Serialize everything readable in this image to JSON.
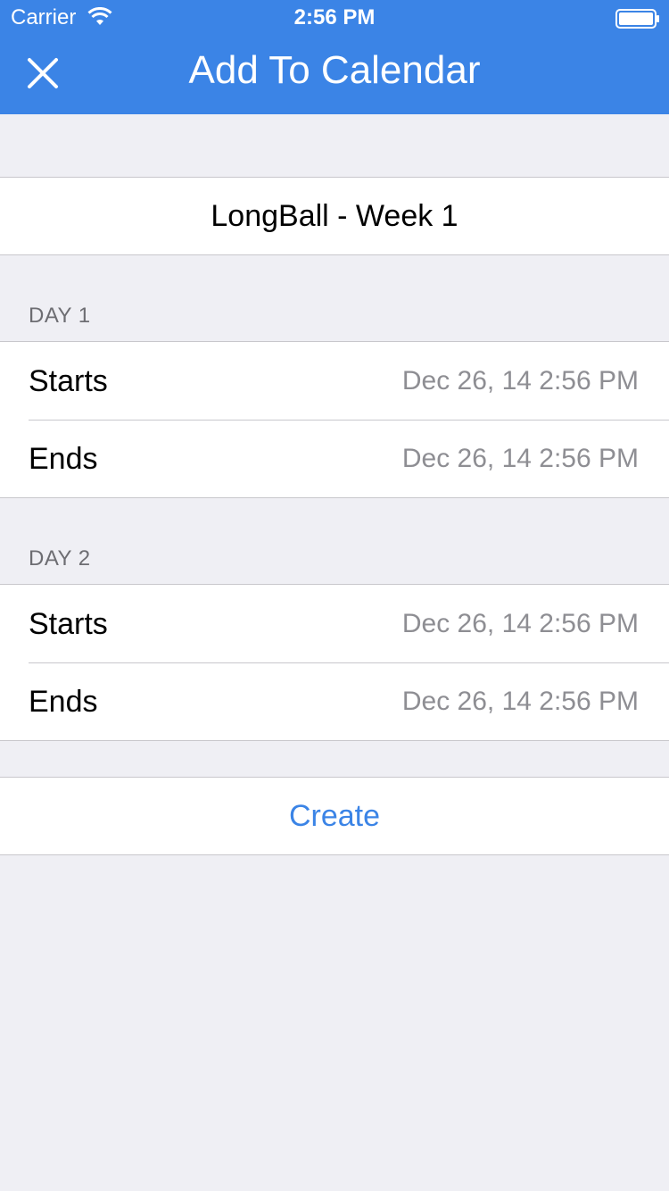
{
  "status_bar": {
    "carrier": "Carrier",
    "time": "2:56 PM"
  },
  "nav": {
    "title": "Add To Calendar",
    "close_icon": "close-icon"
  },
  "event": {
    "title": "LongBall - Week 1"
  },
  "days": [
    {
      "header": "DAY 1",
      "starts_label": "Starts",
      "starts_value": "Dec 26, 14 2:56 PM",
      "ends_label": "Ends",
      "ends_value": "Dec 26, 14 2:56 PM"
    },
    {
      "header": "DAY 2",
      "starts_label": "Starts",
      "starts_value": "Dec 26, 14 2:56 PM",
      "ends_label": "Ends",
      "ends_value": "Dec 26, 14 2:56 PM"
    }
  ],
  "actions": {
    "create_label": "Create"
  },
  "colors": {
    "accent": "#3b84e6",
    "background": "#efeff4",
    "secondary_text": "#8e8e93"
  }
}
